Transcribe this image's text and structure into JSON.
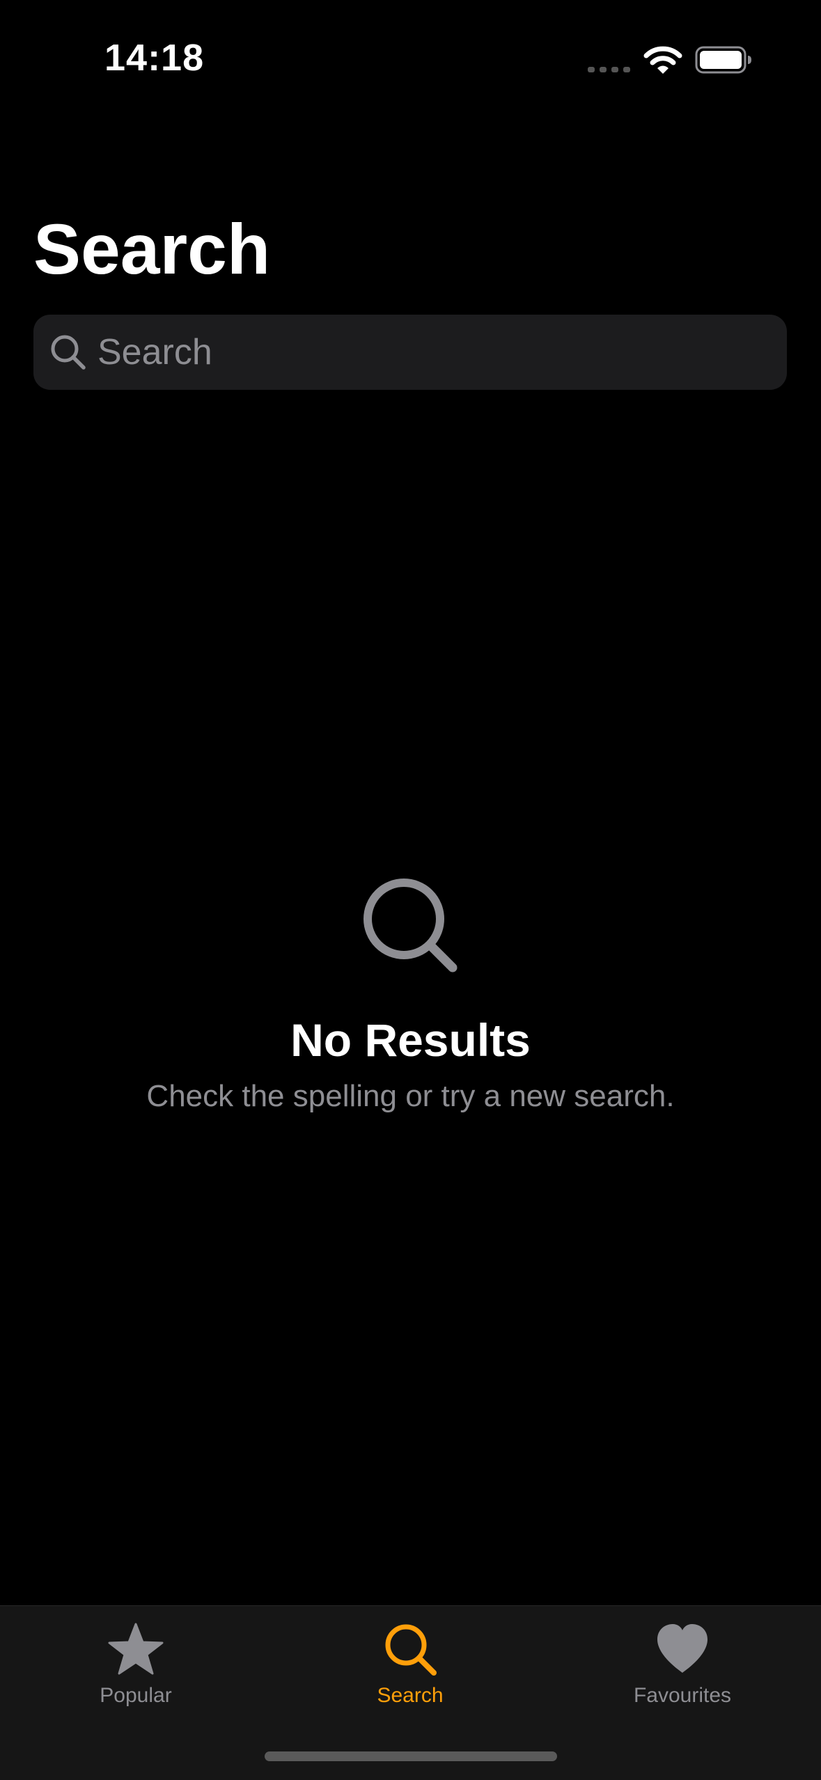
{
  "status_bar": {
    "time": "14:18",
    "icons": [
      "signal-dots-icon",
      "wifi-icon",
      "battery-icon"
    ]
  },
  "header": {
    "title": "Search"
  },
  "search": {
    "placeholder": "Search",
    "value": "",
    "icon": "search-icon"
  },
  "empty_state": {
    "icon": "search-icon",
    "title": "No Results",
    "subtitle": "Check the spelling or try a new search."
  },
  "tab_bar": {
    "active_tab": "Search",
    "tabs": [
      {
        "label": "Popular",
        "icon": "star-icon"
      },
      {
        "label": "Search",
        "icon": "search-icon"
      },
      {
        "label": "Favourites",
        "icon": "heart-icon"
      }
    ]
  },
  "colors": {
    "background": "#000000",
    "accent": "#ff9f0a",
    "secondary_text": "#8e8e93",
    "field_background": "#1c1c1e",
    "tab_bar_background": "#161616"
  }
}
